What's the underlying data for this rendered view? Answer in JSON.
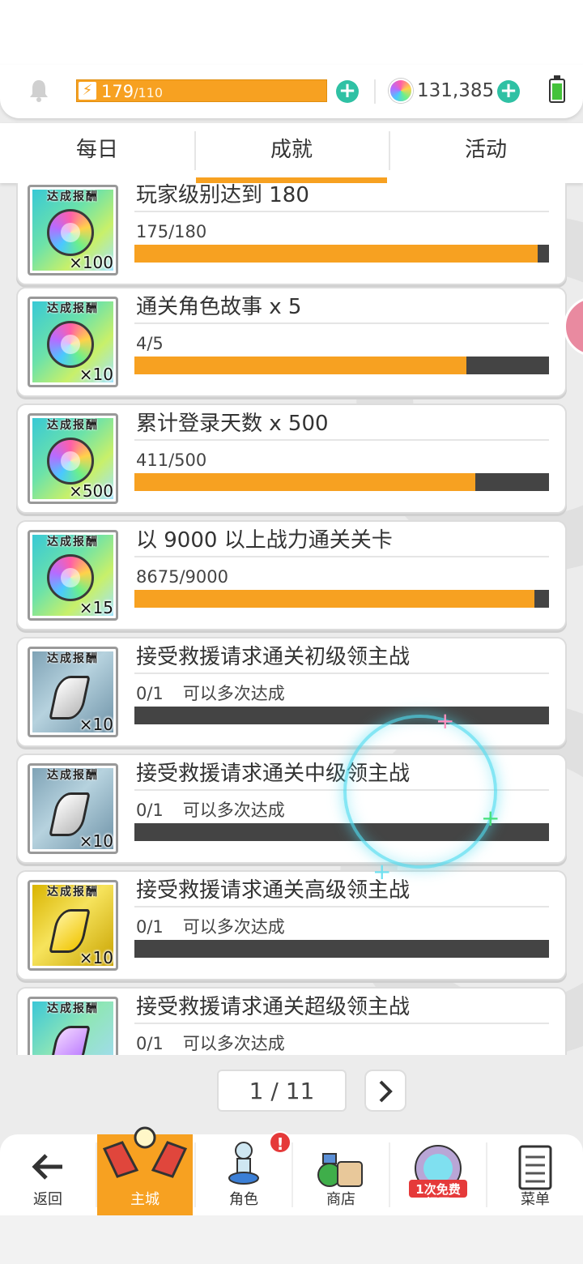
{
  "header": {
    "stamina_current": "179",
    "stamina_max": "/110",
    "gems": "131,385",
    "colors": {
      "accent": "#f7a121",
      "plus": "#2fc1a4"
    }
  },
  "tabs": [
    {
      "label": "每日"
    },
    {
      "label": "成就"
    },
    {
      "label": "活动"
    }
  ],
  "reward_tag": "达成报酬",
  "achievements": [
    {
      "title": "玩家级别达到 180",
      "progress": "175/180",
      "fraction": 0.972,
      "reward_qty": "×100",
      "reward_type": "rainbow-gem",
      "note": ""
    },
    {
      "title": "通关角色故事  x 5",
      "progress": "4/5",
      "fraction": 0.8,
      "reward_qty": "×10",
      "reward_type": "rainbow-gem",
      "note": ""
    },
    {
      "title": "累计登录天数  x 500",
      "progress": "411/500",
      "fraction": 0.822,
      "reward_qty": "×500",
      "reward_type": "rainbow-gem",
      "note": ""
    },
    {
      "title": "以 9000 以上战力通关关卡",
      "progress": "8675/9000",
      "fraction": 0.964,
      "reward_qty": "×15",
      "reward_type": "rainbow-gem",
      "note": ""
    },
    {
      "title": "接受救援请求通关初级领主战",
      "progress": "0/1",
      "fraction": 0,
      "reward_qty": "×10",
      "reward_type": "silver-crystal",
      "note": "可以多次达成"
    },
    {
      "title": "接受救援请求通关中级领主战",
      "progress": "0/1",
      "fraction": 0,
      "reward_qty": "×10",
      "reward_type": "silver-crystal",
      "note": "可以多次达成"
    },
    {
      "title": "接受救援请求通关高级领主战",
      "progress": "0/1",
      "fraction": 0,
      "reward_qty": "×10",
      "reward_type": "gold-crystal",
      "note": "可以多次达成"
    },
    {
      "title": "接受救援请求通关超级领主战",
      "progress": "0/1",
      "fraction": 0,
      "reward_qty": "",
      "reward_type": "purple-crystal",
      "note": "可以多次达成"
    }
  ],
  "pagination": {
    "label": "1 / 11",
    "next": "›"
  },
  "nav": [
    {
      "label": "返回",
      "icon": "back-arrow-icon"
    },
    {
      "label": "主城",
      "icon": "castle-icon"
    },
    {
      "label": "角色",
      "icon": "character-icon",
      "badge": "!"
    },
    {
      "label": "商店",
      "icon": "shop-icon"
    },
    {
      "label": "1次免费\n扭蛋",
      "icon": "gacha-icon"
    },
    {
      "label": "菜单",
      "icon": "menu-list-icon"
    }
  ]
}
